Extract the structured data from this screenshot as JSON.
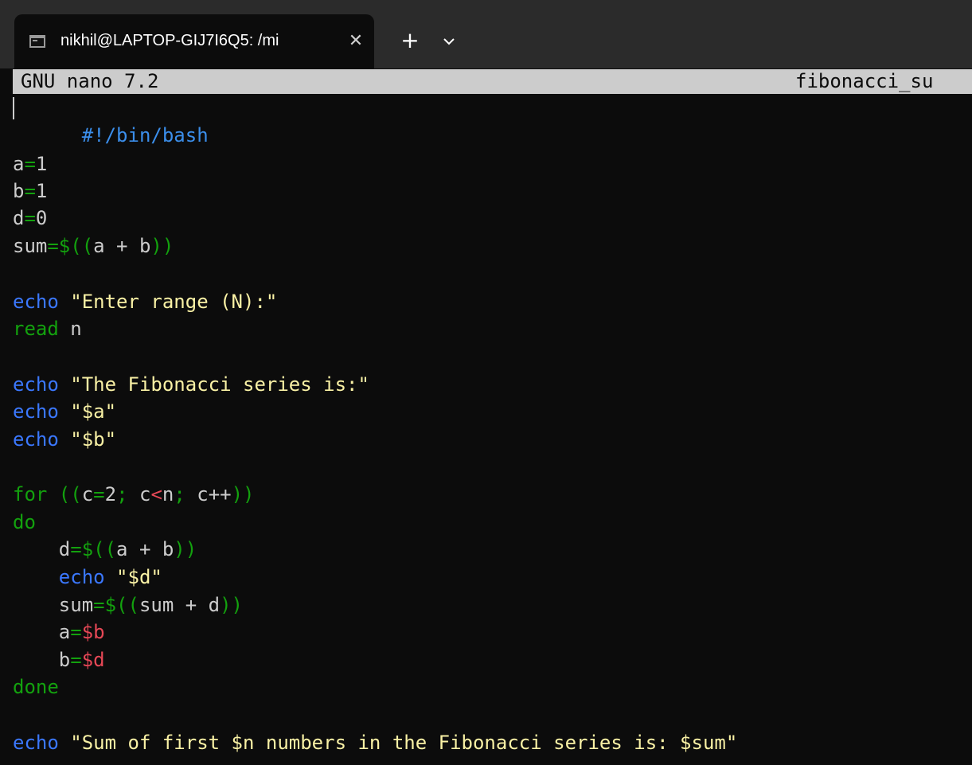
{
  "tab": {
    "title": "nikhil@LAPTOP-GIJ7I6Q5: /mi",
    "close_glyph": "✕",
    "icon": "terminal-icon"
  },
  "tabbar": {
    "new_tab_glyph": "+",
    "dropdown_icon": "chevron-down-icon"
  },
  "nano": {
    "version": "GNU nano 7.2",
    "filename": "fibonacci_su"
  },
  "colors": {
    "background": "#0c0c0c",
    "header_bg": "#cccccc",
    "keyword_green": "#13a10e",
    "builtin_blue": "#3b78ff",
    "string_yellow": "#f9f1a5",
    "variable_red": "#e74856",
    "comment_blue": "#3b8eea"
  },
  "code": {
    "shebang": "#!/bin/bash",
    "l_a_name": "a",
    "l_a_eq": "=",
    "l_a_val": "1",
    "l_b_name": "b",
    "l_b_eq": "=",
    "l_b_val": "1",
    "l_d_name": "d",
    "l_d_eq": "=",
    "l_d_val": "0",
    "l_sum_name": "sum",
    "l_sum_op": "=$((",
    "l_sum_expr": "a + b",
    "l_sum_close": "))",
    "l_echo1_kw": "echo",
    "l_echo1_str": "\"Enter range (N):\"",
    "l_read_kw": "read",
    "l_read_arg": " n",
    "l_echo2_kw": "echo",
    "l_echo2_str": "\"The Fibonacci series is:\"",
    "l_echo3_kw": "echo",
    "l_echo3_str": "\"$a\"",
    "l_echo4_kw": "echo",
    "l_echo4_str": "\"$b\"",
    "l_for_kw": "for",
    "l_for_open": " ((",
    "l_for_c": "c",
    "l_for_eq": "=",
    "l_for_2": "2",
    "l_for_semi1": ";",
    "l_for_c2": " c",
    "l_for_lt": "<",
    "l_for_n": "n",
    "l_for_semi2": ";",
    "l_for_inc": " c++",
    "l_for_close": "))",
    "l_do_kw": "do",
    "l_in1_name": "    d",
    "l_in1_op": "=$((",
    "l_in1_expr": "a + b",
    "l_in1_close": "))",
    "l_in2_kw": "    echo",
    "l_in2_str": "\"$d\"",
    "l_in3_name": "    sum",
    "l_in3_op": "=$((",
    "l_in3_expr": "sum + d",
    "l_in3_close": "))",
    "l_in4_name": "    a",
    "l_in4_eq": "=",
    "l_in4_var": "$b",
    "l_in5_name": "    b",
    "l_in5_eq": "=",
    "l_in5_var": "$d",
    "l_done_kw": "done",
    "l_last_kw": "echo",
    "l_last_str": "\"Sum of first $n numbers in the Fibonacci series is: $sum\""
  }
}
